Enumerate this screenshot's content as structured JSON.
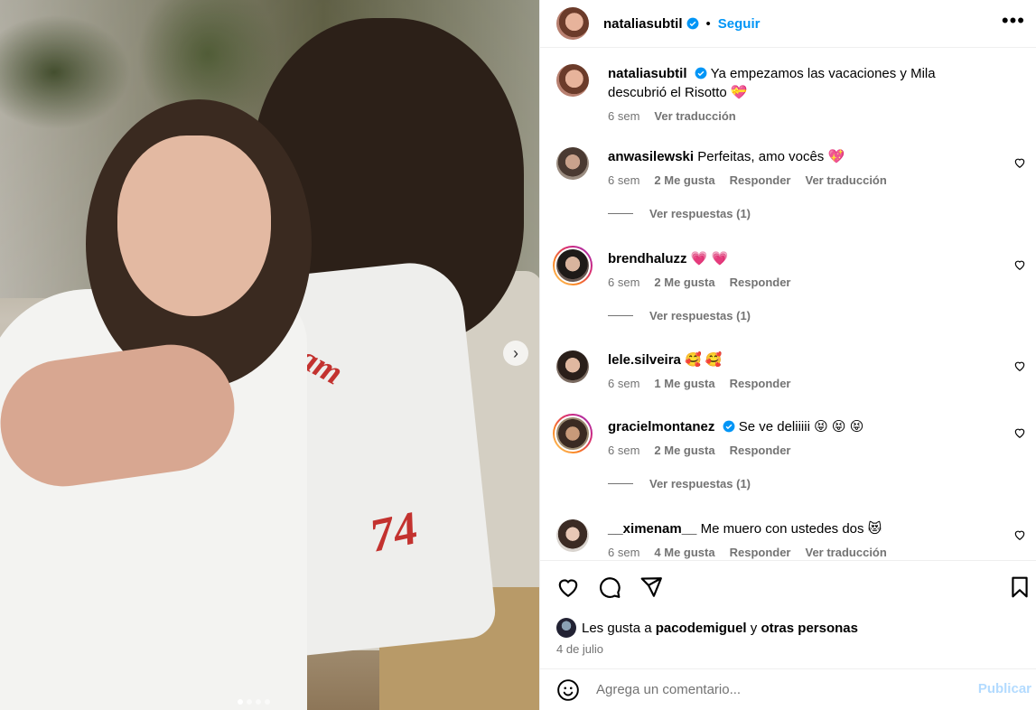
{
  "post": {
    "carousel": {
      "slide_count": 4,
      "active_index": 0,
      "next_icon": "chevron-right-icon"
    },
    "overlay_text": {
      "number": "74",
      "team": "y team"
    }
  },
  "header": {
    "username": "nataliasubtil",
    "verified": true,
    "separator": "•",
    "follow_label": "Seguir",
    "more_icon": "more-horizontal-icon"
  },
  "caption": {
    "username": "nataliasubtil",
    "text": "Ya empezamos las vacaciones y Mila descubrió el Risotto 💝",
    "time": "6 sem",
    "translate": "Ver traducción"
  },
  "comments": [
    {
      "username": "anwasilewski",
      "verified": false,
      "text": "Perfeitas, amo vocês 💖",
      "time": "6 sem",
      "likes": "2 Me gusta",
      "reply": "Responder",
      "translate": "Ver traducción",
      "replies": "Ver respuestas (1)"
    },
    {
      "username": "brendhaluzz",
      "verified": false,
      "text": "💗 💗",
      "time": "6 sem",
      "likes": "2 Me gusta",
      "reply": "Responder",
      "translate": "",
      "replies": "Ver respuestas (1)"
    },
    {
      "username": "lele.silveira",
      "verified": false,
      "text": "🥰 🥰",
      "time": "6 sem",
      "likes": "1 Me gusta",
      "reply": "Responder",
      "translate": "",
      "replies": ""
    },
    {
      "username": "gracielmontanez",
      "verified": true,
      "text": "Se ve deliiiii 😝 😝 😝",
      "time": "6 sem",
      "likes": "2 Me gusta",
      "reply": "Responder",
      "translate": "",
      "replies": "Ver respuestas (1)"
    },
    {
      "username": "__ximenam__",
      "verified": false,
      "text": "Me muero con ustedes dos 😻",
      "time": "6 sem",
      "likes": "4 Me gusta",
      "reply": "Responder",
      "translate": "Ver traducción",
      "replies": ""
    }
  ],
  "actions": {
    "like_icon": "heart-icon",
    "comment_icon": "comment-icon",
    "share_icon": "send-icon",
    "save_icon": "bookmark-icon"
  },
  "likes": {
    "prefix": "Les gusta a",
    "user": "pacodemiguel",
    "conj": "y",
    "others": "otras personas"
  },
  "date": "4 de julio",
  "composer": {
    "emoji_icon": "emoji-icon",
    "placeholder": "Agrega un comentario...",
    "publish_label": "Publicar"
  },
  "colors": {
    "accent": "#0095f6",
    "muted": "#737373",
    "publish_disabled": "#b3dbff",
    "verified": "#0095f6"
  }
}
